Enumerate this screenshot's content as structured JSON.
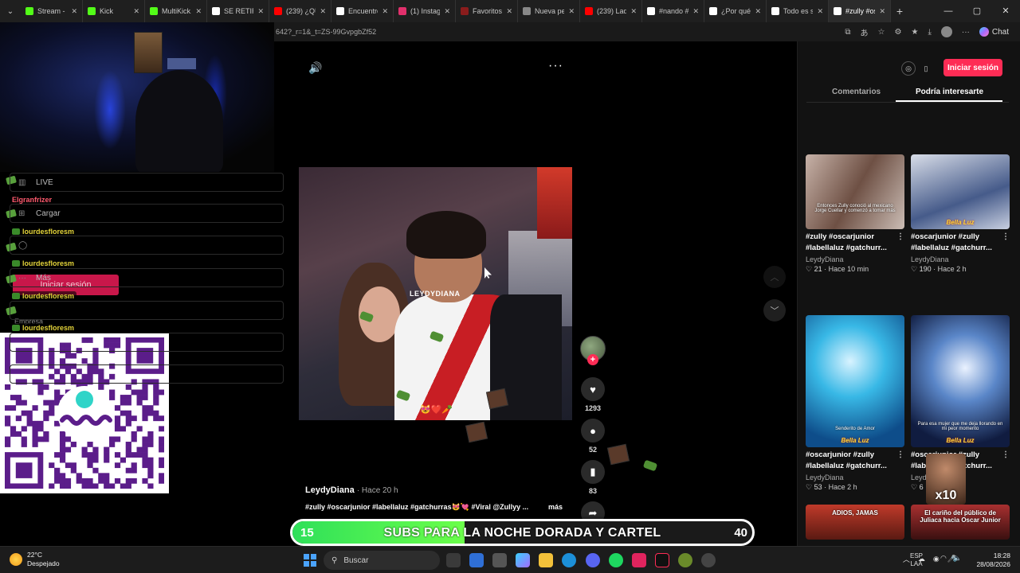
{
  "browser": {
    "tabs": [
      {
        "label": "Stream - Ki",
        "color": "#53fc18"
      },
      {
        "label": "Kick",
        "color": "#53fc18"
      },
      {
        "label": "MultiKick.a",
        "color": "#53fc18"
      },
      {
        "label": "SE RETIRA",
        "color": "#ffffff"
      },
      {
        "label": "(239) ¿QUI",
        "color": "#ff0000"
      },
      {
        "label": "Encuentro",
        "color": "#ffffff"
      },
      {
        "label": "(1) Instagra",
        "color": "#e1306c"
      },
      {
        "label": "Favoritos",
        "color": "#8a1c1c"
      },
      {
        "label": "Nueva pes",
        "color": "#888888"
      },
      {
        "label": "(239) Lady",
        "color": "#ff0000"
      },
      {
        "label": "#nando #",
        "color": "#ffffff"
      },
      {
        "label": "¿Por qué Z",
        "color": "#ffffff"
      },
      {
        "label": "Todo es sh",
        "color": "#ffffff"
      },
      {
        "label": "#zully #osc",
        "color": "#ffffff"
      }
    ],
    "url": "642?_r=1&_t=ZS-99GvpgbZf52",
    "chat_label": "Chat"
  },
  "leftnav": {
    "items": [
      {
        "label": "LIVE",
        "icon": "live-icon"
      },
      {
        "label": "Cargar",
        "icon": "upload-icon"
      },
      {
        "label": "",
        "icon": "profile-icon"
      },
      {
        "label": "Más",
        "icon": "more-icon"
      },
      {
        "label": "",
        "icon": "blank"
      },
      {
        "label": "",
        "icon": "blank"
      },
      {
        "label": "",
        "icon": "blank"
      }
    ],
    "login_label": "Iniciar sesión",
    "empresa_label": "Empresa"
  },
  "chat_overlay": {
    "names": [
      "Elgranfrizer",
      "lourdesfloresm",
      "lourdesfloresm",
      "lourdesfloresm",
      "lourdesfloresm"
    ]
  },
  "player": {
    "watermark": "LEYDYDIANA",
    "hearts": "😻❤️🥕",
    "author": "LeydyDiana",
    "time": "· Hace 20 h",
    "caption": "#zully #oscarjunior #labellaluz #gatchurras😻💘 #Viral @Zullyy ...",
    "more_label": "más",
    "likes": "1293",
    "comments": "52",
    "saves": "83"
  },
  "subgoal": {
    "current": "15",
    "title": "SUBS PARA LA NOCHE DORADA Y CARTEL",
    "target": "40",
    "progress": 0.375
  },
  "rightpanel": {
    "login_label": "Iniciar sesión",
    "tab_comments": "Comentarios",
    "tab_suggested": "Podría interesarte",
    "cards": [
      {
        "title": "#zully #oscarjunior #labellaluz #gatchurr...",
        "author": "LeydyDiana",
        "likes": "21",
        "age": "· Hace 10 min",
        "thumb_text": "Entonces Zully conoció al mexicano Jorge Cuellar y comenzó a tomar más",
        "brand": ""
      },
      {
        "title": "#oscarjunior #zully #labellaluz #gatchurr...",
        "author": "LeydyDiana",
        "likes": "190",
        "age": "· Hace 2 h",
        "thumb_text": "",
        "brand": "Bella Luz"
      },
      {
        "title": "#oscarjunior #zully #labellaluz #gatchurr...",
        "author": "LeydyDiana",
        "likes": "53",
        "age": "· Hace 2 h",
        "thumb_text": "Senderito de Amor",
        "brand": "Bella Luz"
      },
      {
        "title": "#oscarjunior #zully #labellaluz #gatchurr...",
        "author": "Leyd",
        "likes": "6",
        "age": "",
        "thumb_text": "Para esa mujer que me deja llorando en mi peor momento",
        "brand": "Bella Luz"
      },
      {
        "title": "",
        "author": "",
        "likes": "",
        "age": "",
        "thumb_text": "ADIOS, JAMAS",
        "brand": ""
      },
      {
        "title": "",
        "author": "",
        "likes": "",
        "age": "",
        "thumb_text": "El cariño del público de Juliaca hacia Oscar Junior",
        "brand": ""
      }
    ],
    "overlay_badge": "x10"
  },
  "taskbar": {
    "temp": "22°C",
    "weather": "Despejado",
    "search_label": "Buscar",
    "lang_top": "ESP",
    "lang_bottom": "LAA",
    "time": "18:28",
    "date": "28/08/2026"
  },
  "colors": {
    "tiktok_red": "#fe2c55",
    "goal_green": "#2fe05a"
  }
}
